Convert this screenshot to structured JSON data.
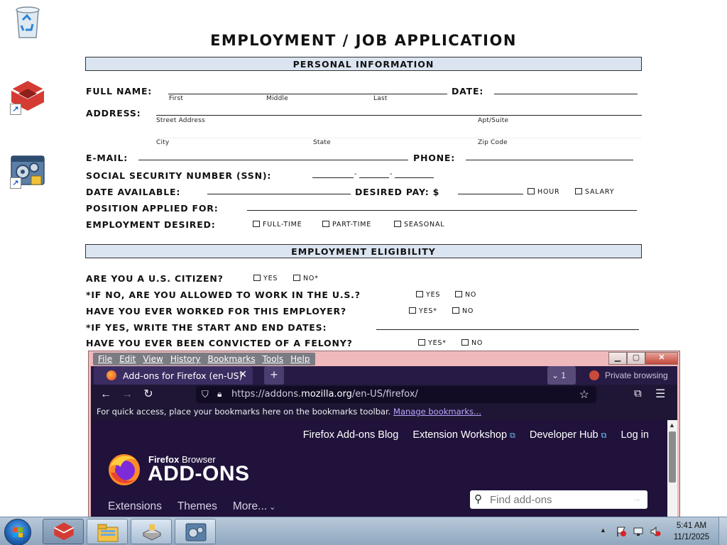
{
  "desktop": {
    "icons": [
      {
        "name": "recycle-bin-icon"
      },
      {
        "name": "app-shortcut-icon"
      },
      {
        "name": "settings-shortcut-icon"
      }
    ]
  },
  "form": {
    "title": "EMPLOYMENT / JOB APPLICATION",
    "section_personal": "PERSONAL INFORMATION",
    "full_name_label": "FULL NAME:",
    "sub_first": "First",
    "sub_middle": "Middle",
    "sub_last": "Last",
    "date_label": "DATE:",
    "address_label": "ADDRESS:",
    "sub_street": "Street Address",
    "sub_apt": "Apt/Suite",
    "sub_city": "City",
    "sub_state": "State",
    "sub_zip": "Zip Code",
    "email_label": "E-MAIL:",
    "phone_label": "PHONE:",
    "ssn_label": "SOCIAL SECURITY NUMBER (SSN):",
    "ssn_sep": "-",
    "date_available_label": "DATE AVAILABLE:",
    "desired_pay_label": "DESIRED PAY: $",
    "opt_hour": "HOUR",
    "opt_salary": "SALARY",
    "position_label": "POSITION APPLIED FOR:",
    "employment_desired_label": "EMPLOYMENT DESIRED:",
    "opt_full_time": "FULL-TIME",
    "opt_part_time": "PART-TIME",
    "opt_seasonal": "SEASONAL",
    "section_eligibility": "EMPLOYMENT ELIGIBILITY",
    "q_citizen": "ARE YOU A U.S. CITIZEN?",
    "q_citizen_yes": "YES",
    "q_citizen_no": "NO*",
    "q_allowed": "*IF NO, ARE YOU ALLOWED TO WORK IN THE U.S.?",
    "q_allowed_yes": "YES",
    "q_allowed_no": "NO",
    "q_worked": "HAVE YOU EVER WORKED FOR THIS EMPLOYER?",
    "q_worked_yes": "YES*",
    "q_worked_no": "NO",
    "q_dates": "*IF YES, WRITE THE START AND END DATES:",
    "q_felony": "HAVE YOU EVER BEEN CONVICTED OF A FELONY?",
    "q_felony_yes": "YES*",
    "q_felony_no": "NO"
  },
  "firefox": {
    "menu": [
      "File",
      "Edit",
      "View",
      "History",
      "Bookmarks",
      "Tools",
      "Help"
    ],
    "tab_title": "Add-ons for Firefox (en-US)",
    "tab_close": "✕",
    "new_tab": "+",
    "tab_count": "1",
    "private_label": "Private browsing",
    "url_prefix": "https://addons.",
    "url_domain": "mozilla.org",
    "url_suffix": "/en-US/firefox/",
    "bookmarks_text": "For quick access, place your bookmarks here on the bookmarks toolbar. ",
    "bookmarks_link": "Manage bookmarks...",
    "amo": {
      "links": [
        "Firefox Add-ons Blog",
        "Extension Workshop",
        "Developer Hub",
        "Log in"
      ],
      "brand_top": "Firefox",
      "brand_top_rest": " Browser",
      "brand_main": "ADD-ONS",
      "nav": [
        "Extensions",
        "Themes",
        "More..."
      ],
      "search_placeholder": "Find add-ons"
    }
  },
  "taskbar": {
    "clock_time": "5:41 AM",
    "clock_date": "11/1/2025"
  }
}
